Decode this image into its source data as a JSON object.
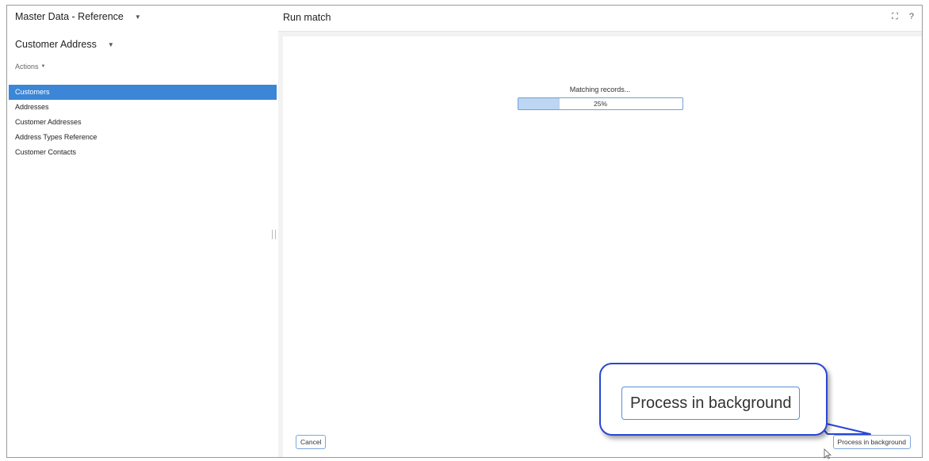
{
  "left_panel": {
    "app_title": "Master Data - Reference",
    "entity_title": "Customer Address",
    "actions_label": "Actions",
    "nav_items": [
      {
        "label": "Customers",
        "active": true
      },
      {
        "label": "Addresses",
        "active": false
      },
      {
        "label": "Customer Addresses",
        "active": false
      },
      {
        "label": "Address Types Reference",
        "active": false
      },
      {
        "label": "Customer Contacts",
        "active": false
      }
    ]
  },
  "right_panel": {
    "title": "Run match",
    "icons": [
      "expand-icon",
      "help-icon"
    ],
    "progress": {
      "label": "Matching records...",
      "value_text": "25%",
      "fraction": 0.25
    },
    "buttons": {
      "cancel": "Cancel",
      "process_background": "Process in background"
    },
    "callout_label": "Process in background"
  },
  "colors": {
    "accent": "#3b86d6",
    "progress_fill": "#bcd6f3",
    "callout_border": "#2a46d4"
  }
}
